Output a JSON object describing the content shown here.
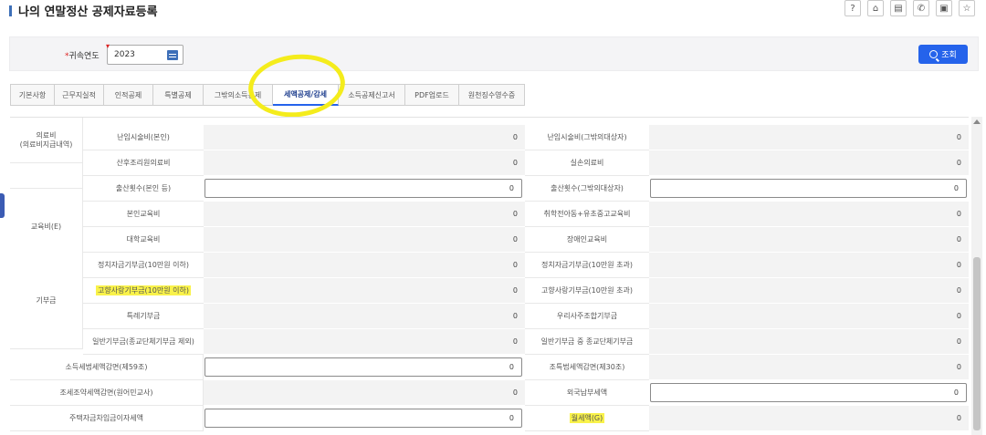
{
  "page": {
    "title": "나의 연말정산 공제자료등록"
  },
  "top_icons": [
    "help-icon",
    "car-icon",
    "document-icon",
    "phone-icon",
    "calendar-icon",
    "star-icon"
  ],
  "search": {
    "year_label": "귀속연도",
    "year_required_mark": "*",
    "year_value": "2023",
    "query_button": "조회"
  },
  "tabs": [
    {
      "label": "기본사항",
      "active": false
    },
    {
      "label": "근무지실적",
      "active": false
    },
    {
      "label": "인적공제",
      "active": false
    },
    {
      "label": "특별공제",
      "active": false
    },
    {
      "label": "그밖의소득공제",
      "active": false
    },
    {
      "label": "세액공제/감세",
      "active": true
    },
    {
      "label": "소득공제신고서",
      "active": false
    },
    {
      "label": "PDF업로드",
      "active": false
    },
    {
      "label": "원천징수영수증",
      "active": false
    }
  ],
  "categories": {
    "medical": "의료비\n(의료비지급내역)",
    "education": "교육비(E)",
    "donation": "기부금"
  },
  "rows": [
    {
      "left_label": "난임시술비(본인)",
      "left_value": "0",
      "right_label": "난임시술비(그밖의대상자)",
      "right_value": "0"
    },
    {
      "left_label": "산후조리원의료비",
      "left_value": "0",
      "right_label": "실손의료비",
      "right_value": "0"
    },
    {
      "left_label": "출산횟수(본인 등)",
      "left_value": "0",
      "right_label": "출산횟수(그밖의대상자)",
      "right_value": "0"
    },
    {
      "left_label": "본인교육비",
      "left_value": "0",
      "right_label": "취학전아동+유초중고교육비",
      "right_value": "0"
    },
    {
      "left_label": "대학교육비",
      "left_value": "0",
      "right_label": "장애인교육비",
      "right_value": "0"
    },
    {
      "left_label": "정치자금기부금(10만원 이하)",
      "left_value": "0",
      "right_label": "정치자금기부금(10만원 초과)",
      "right_value": "0"
    },
    {
      "left_label": "고향사랑기부금(10만원 이하)",
      "left_value": "0",
      "right_label": "고향사랑기부금(10만원 초과)",
      "right_value": "0"
    },
    {
      "left_label": "특례기부금",
      "left_value": "0",
      "right_label": "우리사주조합기부금",
      "right_value": "0"
    },
    {
      "left_label": "일반기부금(종교단체기부금 제외)",
      "left_value": "0",
      "right_label": "일반기부금 중 종교단체기부금",
      "right_value": "0"
    },
    {
      "left_label": "소득세법세액감면(제59조)",
      "left_value": "0",
      "right_label": "조특법세액감면(제30조)",
      "right_value": "0"
    },
    {
      "left_label": "조세조약세액감면(원어민교사)",
      "left_value": "0",
      "right_label": "외국납부세액",
      "right_value": "0"
    },
    {
      "left_label": "주택자금차입금이자세액",
      "left_value": "0",
      "right_label": "월세액(G)",
      "right_value": "0"
    }
  ],
  "colors": {
    "accent": "#2563eb",
    "highlight": "#f4ec1c"
  }
}
